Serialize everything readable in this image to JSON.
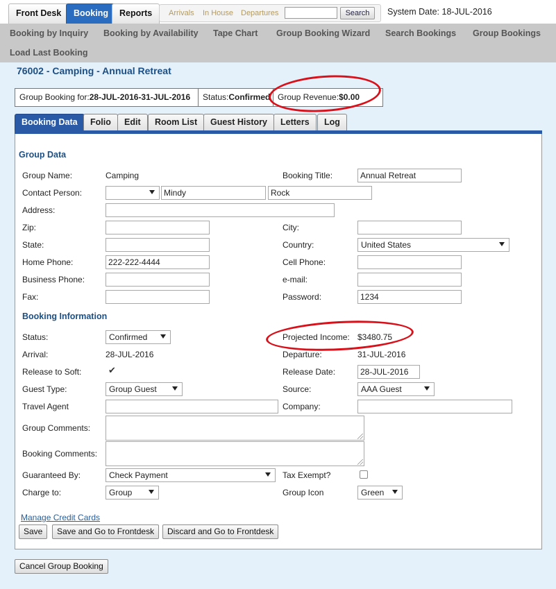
{
  "main_tabs": [
    "Front Desk",
    "Booking",
    "Reports"
  ],
  "quick_links": [
    "Arrivals",
    "In House",
    "Departures"
  ],
  "quick_search": {
    "value": "",
    "button": "Search"
  },
  "system_date": "System Date: 18-JUL-2016",
  "sub_nav": [
    "Booking by Inquiry",
    "Booking by Availability",
    "Tape Chart",
    "Group Booking Wizard",
    "Search Bookings",
    "Group Bookings",
    "Load Last Booking"
  ],
  "page_title": "76002 - Camping - Annual Retreat",
  "info_bar": {
    "group_booking_label": "Group Booking for:",
    "group_booking_dates": "28-JUL-2016-31-JUL-2016",
    "status_label": "Status:",
    "status_value": "Confirmed",
    "revenue_label": "Group Revenue:",
    "revenue_value": "$0.00"
  },
  "tabs": [
    "Booking Data",
    "Folio",
    "Edit",
    "Room List",
    "Guest History",
    "Letters",
    "Log"
  ],
  "group_data": {
    "heading": "Group Data",
    "group_name_label": "Group Name:",
    "group_name": "Camping",
    "booking_title_label": "Booking Title:",
    "booking_title": "Annual Retreat",
    "contact_label": "Contact Person:",
    "contact_salutation": "",
    "contact_first": "Mindy",
    "contact_last": "Rock",
    "address_label": "Address:",
    "address": "",
    "zip_label": "Zip:",
    "zip": "",
    "city_label": "City:",
    "city": "",
    "state_label": "State:",
    "state": "",
    "country_label": "Country:",
    "country": "United States",
    "home_phone_label": "Home Phone:",
    "home_phone": "222-222-4444",
    "cell_phone_label": "Cell Phone:",
    "cell_phone": "",
    "business_phone_label": "Business Phone:",
    "business_phone": "",
    "email_label": "e-mail:",
    "email": "",
    "fax_label": "Fax:",
    "fax": "",
    "password_label": "Password:",
    "password": "1234"
  },
  "booking_info": {
    "heading": "Booking Information",
    "status_label": "Status:",
    "status": "Confirmed",
    "projected_income_label": "Projected Income:",
    "projected_income": "$3480.75",
    "arrival_label": "Arrival:",
    "arrival": "28-JUL-2016",
    "departure_label": "Departure:",
    "departure": "31-JUL-2016",
    "release_soft_label": "Release to Soft:",
    "release_soft_checked": true,
    "release_date_label": "Release Date:",
    "release_date": "28-JUL-2016",
    "guest_type_label": "Guest Type:",
    "guest_type": "Group Guest",
    "source_label": "Source:",
    "source": "AAA Guest",
    "travel_agent_label": "Travel Agent",
    "travel_agent": "",
    "company_label": "Company:",
    "company": "",
    "group_comments_label": "Group Comments:",
    "booking_comments_label": "Booking Comments:",
    "guaranteed_by_label": "Guaranteed By:",
    "guaranteed_by": "Check Payment",
    "tax_exempt_label": "Tax Exempt?",
    "tax_exempt_checked": false,
    "charge_to_label": "Charge to:",
    "charge_to": "Group",
    "group_icon_label": "Group Icon",
    "group_icon": "Green"
  },
  "manage_credit_cards": "Manage Credit Cards",
  "buttons": {
    "save": "Save",
    "save_frontdesk": "Save and Go to Frontdesk",
    "discard_frontdesk": "Discard and Go to Frontdesk",
    "cancel_group": "Cancel Group Booking"
  },
  "colors": {
    "accent": "#2a59a5",
    "annotation": "#d8101a",
    "title": "#1c4f84"
  }
}
